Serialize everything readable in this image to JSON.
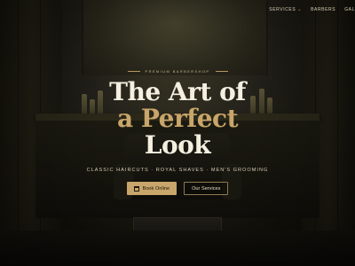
{
  "nav": {
    "items": [
      {
        "label": "SERVICES",
        "has_dropdown": true
      },
      {
        "label": "BARBERS",
        "has_dropdown": false
      },
      {
        "label": "GAL",
        "has_dropdown": false
      }
    ],
    "dropdown_icon": "chevron-down-icon"
  },
  "hero": {
    "eyebrow": "PREMIUM BARBERSHOP",
    "title_line1": "The Art of",
    "title_line2": "a Perfect",
    "title_line3": "Look",
    "tagline": "CLASSIC HAIRCUTS · ROYAL SHAVES · MEN'S GROOMING",
    "primary_button": {
      "label": "Book Online",
      "icon": "calendar-icon"
    },
    "secondary_button": {
      "label": "Our Services"
    }
  },
  "colors": {
    "accent": "#c8a56a",
    "title": "#f5efe0",
    "background": "#121109"
  }
}
